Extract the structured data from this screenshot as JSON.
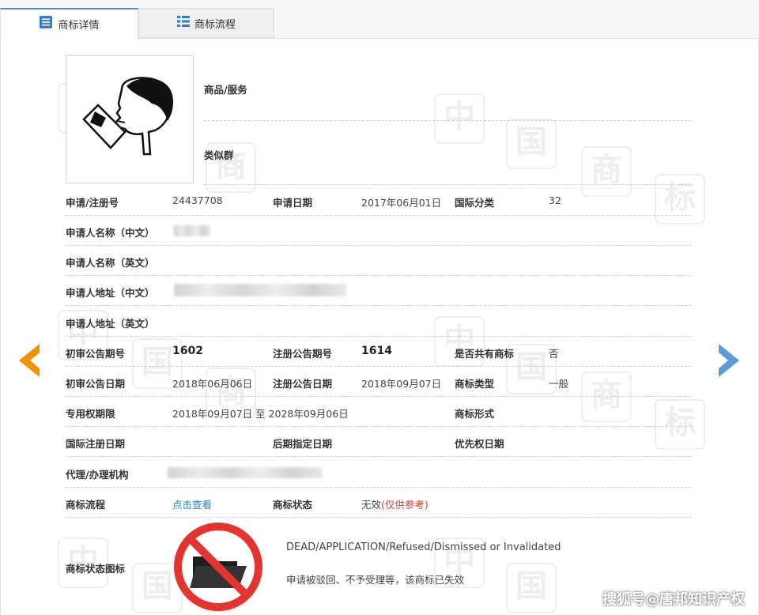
{
  "tabs": [
    {
      "label": "商标详情",
      "icon": "document-list-icon"
    },
    {
      "label": "商标流程",
      "icon": "list-icon"
    }
  ],
  "watermark_chars": [
    "中",
    "国",
    "商",
    "标"
  ],
  "goods": {
    "label": "商品/服务",
    "value": ""
  },
  "similar_group": {
    "label": "类似群",
    "value": ""
  },
  "fields": {
    "app_no_label": "申请/注册号",
    "app_no_value": "24437708",
    "app_date_label": "申请日期",
    "app_date_value": "2017年06月01日",
    "intl_class_label": "国际分类",
    "intl_class_value": "32",
    "applicant_cn_label": "申请人名称（中文）",
    "applicant_en_label": "申请人名称（英文）",
    "address_cn_label": "申请人地址（中文）",
    "address_en_label": "申请人地址（英文）",
    "prelim_issue_label": "初审公告期号",
    "prelim_issue_value": "1602",
    "reg_issue_label": "注册公告期号",
    "reg_issue_value": "1614",
    "shared_label": "是否共有商标",
    "shared_value": "否",
    "prelim_date_label": "初审公告日期",
    "prelim_date_value": "2018年06月06日",
    "reg_date_label": "注册公告日期",
    "reg_date_value": "2018年09月07日",
    "mark_type_label": "商标类型",
    "mark_type_value": "一般",
    "exclusive_label": "专用权期限",
    "exclusive_value": "2018年09月07日 至 2028年09月06日",
    "mark_form_label": "商标形式",
    "intl_reg_date_label": "国际注册日期",
    "later_designation_label": "后期指定日期",
    "priority_date_label": "优先权日期",
    "agent_label": "代理/办理机构",
    "flow_label": "商标流程",
    "flow_link": "点击查看",
    "status_label": "商标状态",
    "status_value": "无效",
    "status_note": "(仅供参考)",
    "status_icon_label": "商标状态图标",
    "status_en": "DEAD/APPLICATION/Refused/Dismissed or Invalidated",
    "status_cn": "申请被驳回、不予受理等，该商标已失效"
  },
  "footer_mark": "搜狐号@唐邦知识产权",
  "colors": {
    "prev_arrow": "#f39200",
    "next_arrow": "#5b9bd5",
    "status_red": "#e43a2d",
    "link_blue": "#2a7fc7"
  }
}
